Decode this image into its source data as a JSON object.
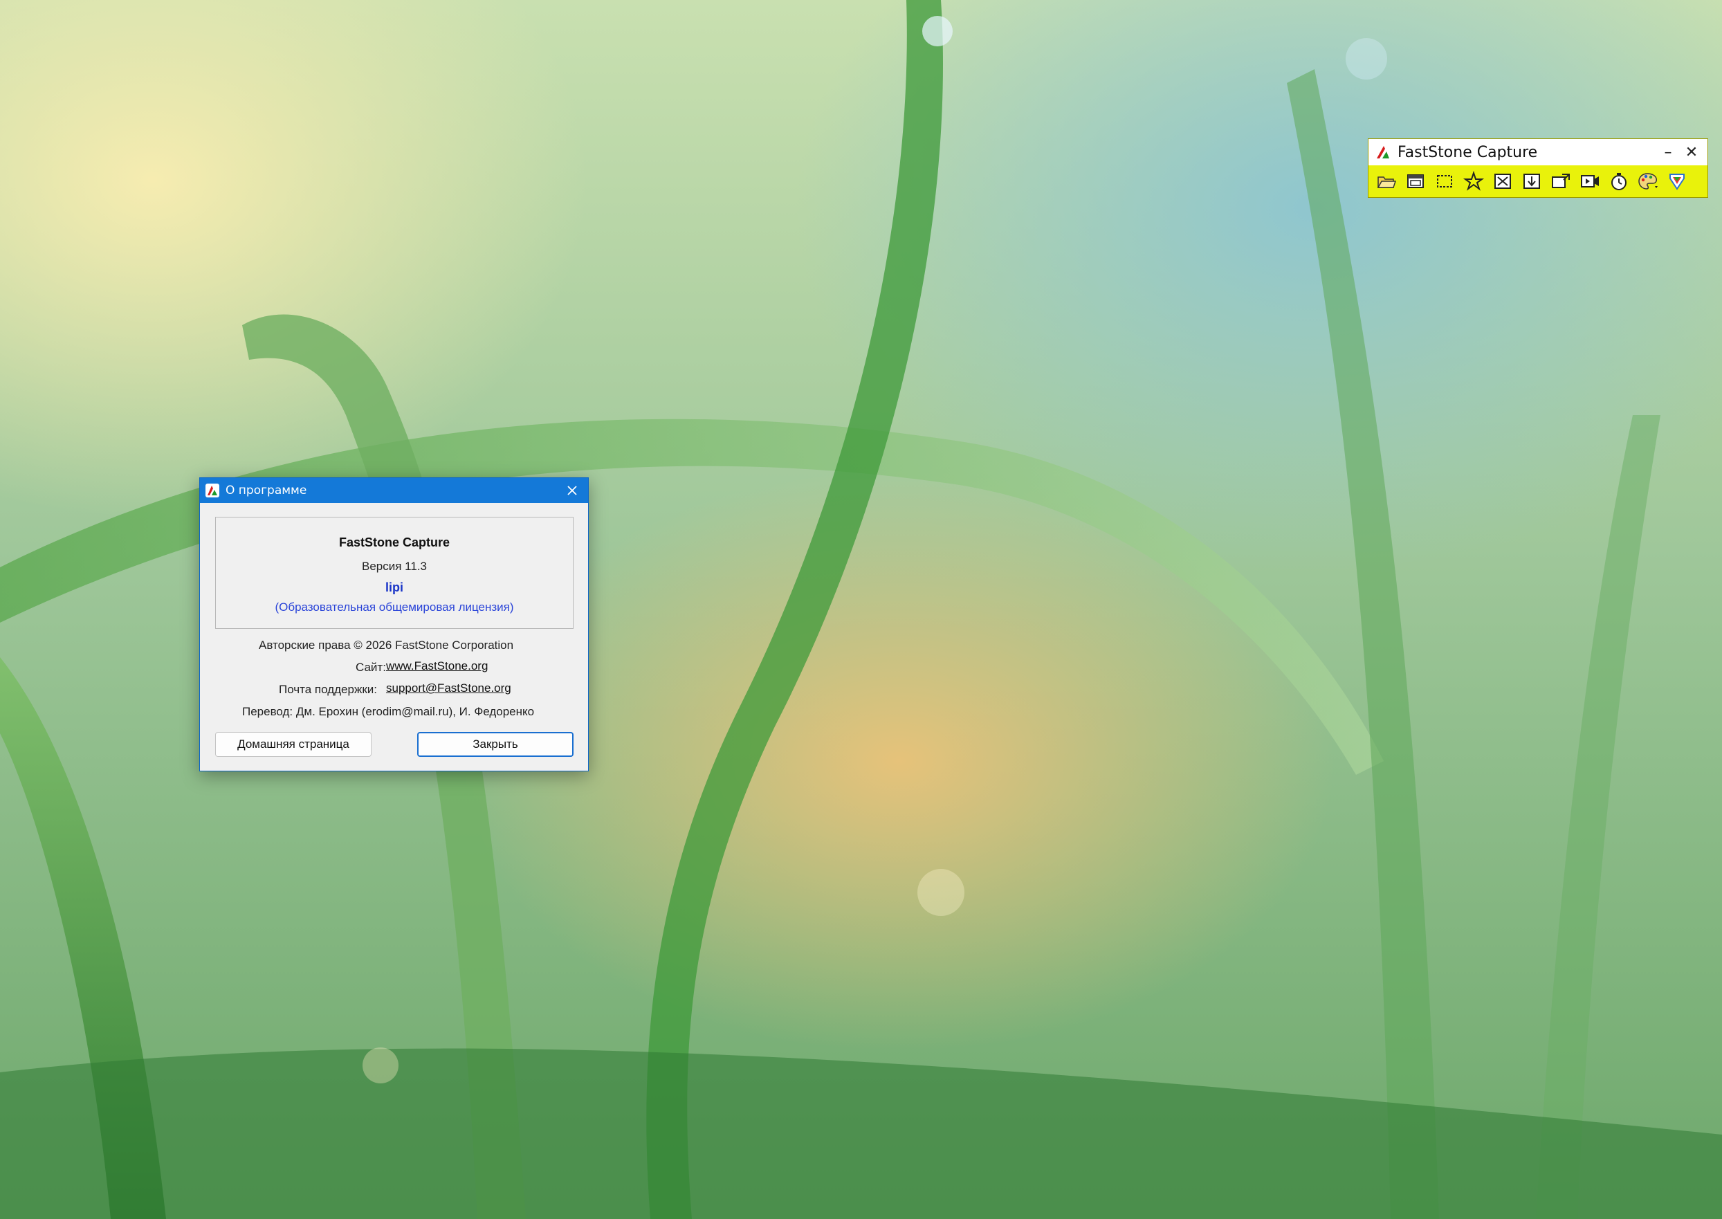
{
  "toolbar": {
    "title": "FastStone Capture",
    "minimize_glyph": "–",
    "close_glyph": "✕",
    "icons": [
      "open-folder-icon",
      "capture-window-icon",
      "capture-rectangle-icon",
      "capture-freehand-icon",
      "capture-fullscreen-icon",
      "capture-scrolling-icon",
      "capture-fixed-region-icon",
      "screen-recorder-icon",
      "delay-timer-icon",
      "color-palette-icon",
      "settings-menu-icon"
    ]
  },
  "dialog": {
    "title": "О программе",
    "product": "FastStone Capture",
    "version": "Версия 11.3",
    "user": "lipi",
    "license": "(Образовательная общемировая лицензия)",
    "copyright": "Авторские права © 2026 FastStone Corporation",
    "site_label": "Сайт:",
    "site_url": "www.FastStone.org",
    "support_label": "Почта поддержки:",
    "support_email": "support@FastStone.org",
    "translation": "Перевод: Дм. Ерохин (erodim@mail.ru), И. Федоренко",
    "home_button": "Домашняя страница",
    "close_button": "Закрыть"
  }
}
